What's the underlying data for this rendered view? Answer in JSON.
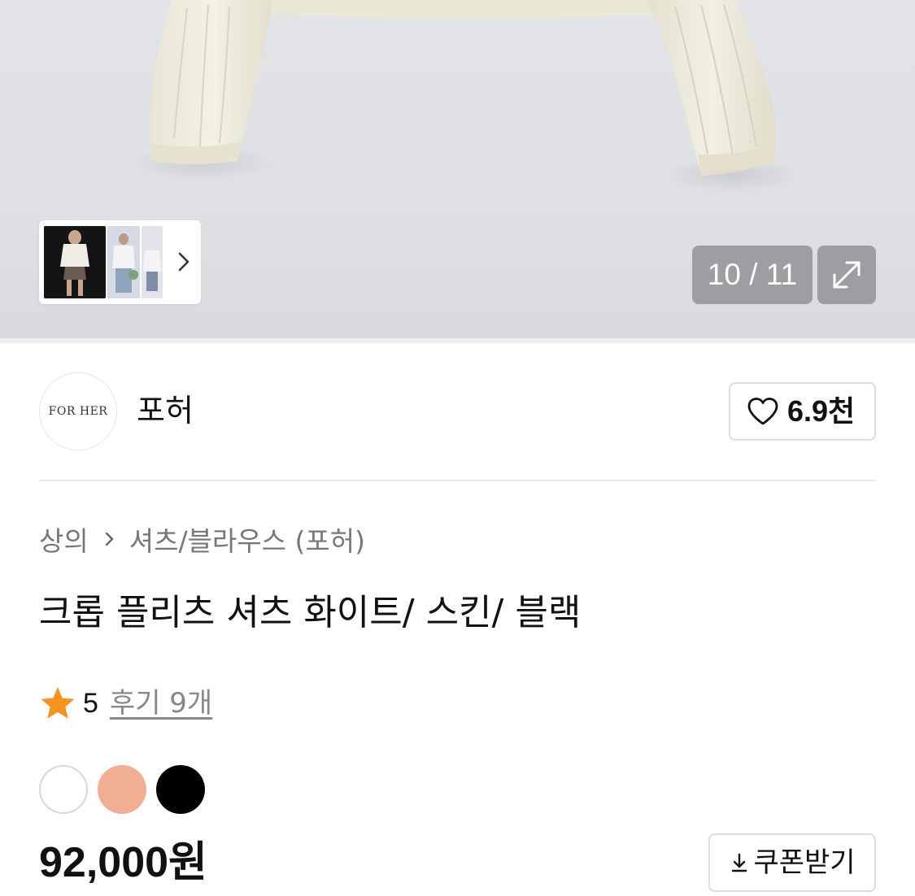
{
  "gallery": {
    "counter_text": "10 / 11",
    "current_index": 10,
    "total": 11,
    "thumbnails_visible": 3,
    "next_icon": "chevron-right-icon",
    "expand_icon": "expand-icon"
  },
  "brand": {
    "logo_text": "FOR HER",
    "name": "포허",
    "likes_label": "6.9천",
    "like_icon": "heart-outline-icon"
  },
  "breadcrumb": {
    "category": "상의",
    "subcategory": "셔츠/블라우스 (포허)",
    "separator_icon": "chevron-right-icon"
  },
  "product": {
    "title": "크롭 플리츠 셔츠 화이트/ 스킨/ 블랙",
    "rating": "5",
    "review_label": "후기 9개",
    "price": "92,000원",
    "colors": [
      {
        "name": "white",
        "hex": "#ffffff"
      },
      {
        "name": "skin",
        "hex": "#f1ae92"
      },
      {
        "name": "black",
        "hex": "#000000"
      }
    ],
    "star_color": "#f7931e"
  },
  "coupon": {
    "label": "쿠폰받기",
    "icon": "download-arrow-icon"
  }
}
